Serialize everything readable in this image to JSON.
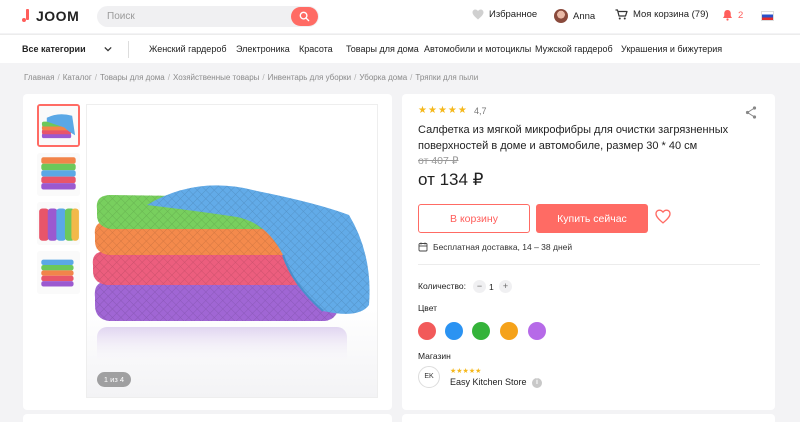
{
  "header": {
    "logo_text": "JOOM",
    "search_placeholder": "Поиск",
    "favorites_label": "Избранное",
    "user_name": "Anna",
    "cart_label": "Моя корзина (79)",
    "notifications_count": "2",
    "colors": {
      "accent": "#ff6b64"
    }
  },
  "nav": {
    "all_categories": "Все категории",
    "items": [
      "Женский гардероб",
      "Электроника",
      "Красота",
      "Товары для дома",
      "Автомобили и мотоциклы",
      "Мужской гардероб",
      "Украшения и бижутерия"
    ]
  },
  "breadcrumbs": [
    "Главная",
    "Каталог",
    "Товары для дома",
    "Хозяйственные товары",
    "Инвентарь для уборки",
    "Уборка дома",
    "Тряпки для пыли"
  ],
  "gallery": {
    "counter": "1 из 4",
    "thumbnail_count": 4
  },
  "product": {
    "rating": "4,7",
    "stars": 5,
    "title": "Салфетка из мягкой микрофибры для очистки загрязненных поверхностей в доме и автомобиле, размер 30 * 40 см",
    "old_price": "от 407 ₽",
    "price": "от 134 ₽",
    "add_to_cart": "В корзину",
    "buy_now": "Купить сейчас",
    "delivery": "Бесплатная доставка, 14 – 38 дней",
    "quantity_label": "Количество:",
    "quantity_value": "1",
    "color_label": "Цвет",
    "colors": [
      "#f25a5a",
      "#2b93f2",
      "#35b33a",
      "#f5a21a",
      "#b66ae8"
    ],
    "shop_label": "Магазин",
    "shop_initials": "EK",
    "shop_name": "Easy Kitchen Store",
    "shop_rating": 4.5
  }
}
